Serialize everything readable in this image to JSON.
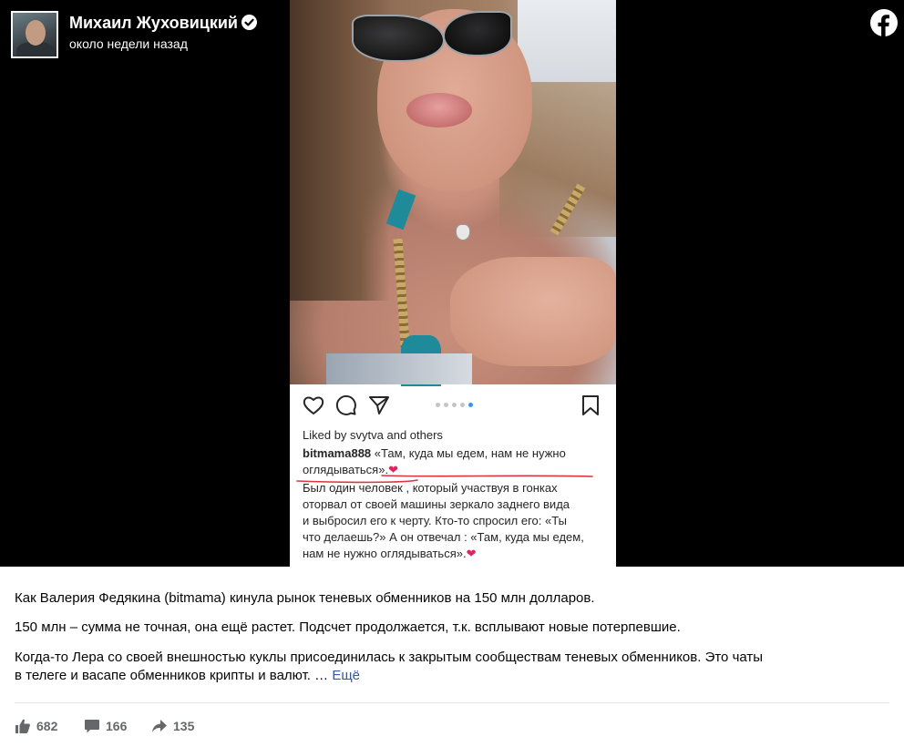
{
  "post": {
    "author_name": "Михаил Жуховицкий",
    "time": "около недели назад"
  },
  "icons": {
    "verified": "verified-check-icon",
    "platform": "facebook-logo-icon",
    "like": "thumbs-up-icon",
    "comment": "speech-bubble-icon",
    "share": "share-arrow-icon"
  },
  "instagram_screenshot": {
    "likes_text": "Liked by svytva and others",
    "caption_user": "bitmama888",
    "caption_quote_line1": "«Там, куда мы едем, нам не нужно",
    "caption_quote_line2": "оглядываться».",
    "body_lines": [
      "Был один человек , который участвуя в гонках",
      "оторвал от своей машины зеркало заднего вида",
      "и выбросил его к черту.  Кто-то спросил его: «Ты",
      "что делаешь?» А он отвечал : «Там, куда мы едем,",
      "нам не нужно оглядываться»."
    ],
    "heart_emoji": "❤",
    "carousel_active_index": 4,
    "carousel_count": 5
  },
  "text": {
    "paragraph1": "Как Валерия Федякина (bitmama) кинула рынок теневых обменников на 150 млн долларов.",
    "paragraph2": "150 млн – сумма не точная, она ещё растет. Подсчет продолжается, т.к. всплывают новые потерпевшие.",
    "paragraph3_line1": "Когда-то Лера со своей внешностью куклы присоединилась к закрытым сообществам теневых обменников. Это чаты",
    "paragraph3_line2": "в телеге и васапе обменников крипты и валют. … ",
    "see_more": "Ещё"
  },
  "stats": {
    "likes": "682",
    "comments": "166",
    "shares": "135"
  },
  "colors": {
    "facebook_blue": "#1877f2",
    "link": "#385898",
    "stat_gray": "#65676b",
    "heart_red": "#e0245e",
    "underline_red": "#d9363e",
    "carousel_active": "#3897f0"
  }
}
